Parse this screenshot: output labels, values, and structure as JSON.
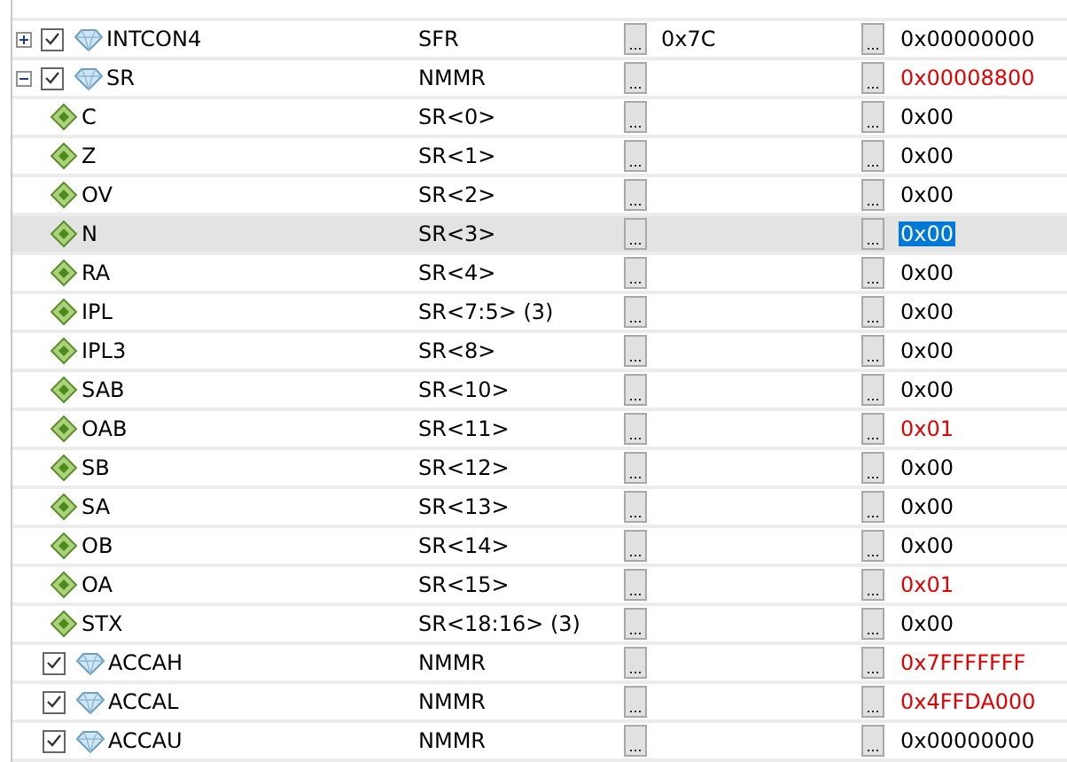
{
  "rows": [
    {
      "kind": "register",
      "name": "INTCON4",
      "type": "SFR",
      "buttons": [
        "...",
        "..."
      ],
      "address": "0x7C",
      "value": "0x00000000",
      "changed": false,
      "checked": true,
      "expanded": false,
      "selected": false
    },
    {
      "kind": "register",
      "name": "SR",
      "type": "NMMR",
      "buttons": [
        "...",
        "..."
      ],
      "value": "0x00008800",
      "changed": true,
      "checked": true,
      "expanded": true,
      "selected": false,
      "children": [
        {
          "kind": "bit",
          "name": "C",
          "type": "SR<0>",
          "buttons": [
            "...",
            "..."
          ],
          "value": "0x00",
          "changed": false,
          "selected": false
        },
        {
          "kind": "bit",
          "name": "Z",
          "type": "SR<1>",
          "buttons": [
            "...",
            "..."
          ],
          "value": "0x00",
          "changed": false,
          "selected": false
        },
        {
          "kind": "bit",
          "name": "OV",
          "type": "SR<2>",
          "buttons": [
            "...",
            "..."
          ],
          "value": "0x00",
          "changed": false,
          "selected": false
        },
        {
          "kind": "bit",
          "name": "N",
          "type": "SR<3>",
          "buttons": [
            "...",
            "..."
          ],
          "value": "0x00",
          "changed": false,
          "selected": true
        },
        {
          "kind": "bit",
          "name": "RA",
          "type": "SR<4>",
          "buttons": [
            "...",
            "..."
          ],
          "value": "0x00",
          "changed": false,
          "selected": false
        },
        {
          "kind": "bit",
          "name": "IPL",
          "type": "SR<7:5> (3)",
          "buttons": [
            "...",
            "..."
          ],
          "value": "0x00",
          "changed": false,
          "selected": false
        },
        {
          "kind": "bit",
          "name": "IPL3",
          "type": "SR<8>",
          "buttons": [
            "...",
            "..."
          ],
          "value": "0x00",
          "changed": false,
          "selected": false
        },
        {
          "kind": "bit",
          "name": "SAB",
          "type": "SR<10>",
          "buttons": [
            "...",
            "..."
          ],
          "value": "0x00",
          "changed": false,
          "selected": false
        },
        {
          "kind": "bit",
          "name": "OAB",
          "type": "SR<11>",
          "buttons": [
            "...",
            "..."
          ],
          "value": "0x01",
          "changed": true,
          "selected": false
        },
        {
          "kind": "bit",
          "name": "SB",
          "type": "SR<12>",
          "buttons": [
            "...",
            "..."
          ],
          "value": "0x00",
          "changed": false,
          "selected": false
        },
        {
          "kind": "bit",
          "name": "SA",
          "type": "SR<13>",
          "buttons": [
            "...",
            "..."
          ],
          "value": "0x00",
          "changed": false,
          "selected": false
        },
        {
          "kind": "bit",
          "name": "OB",
          "type": "SR<14>",
          "buttons": [
            "...",
            "..."
          ],
          "value": "0x00",
          "changed": false,
          "selected": false
        },
        {
          "kind": "bit",
          "name": "OA",
          "type": "SR<15>",
          "buttons": [
            "...",
            "..."
          ],
          "value": "0x01",
          "changed": true,
          "selected": false
        },
        {
          "kind": "bit",
          "name": "STX",
          "type": "SR<18:16> (3)",
          "buttons": [
            "...",
            "..."
          ],
          "value": "0x00",
          "changed": false,
          "selected": false
        }
      ]
    },
    {
      "kind": "register",
      "name": "ACCAH",
      "type": "NMMR",
      "buttons": [
        "...",
        "..."
      ],
      "value": "0x7FFFFFFF",
      "changed": true,
      "checked": true,
      "selected": false
    },
    {
      "kind": "register",
      "name": "ACCAL",
      "type": "NMMR",
      "buttons": [
        "...",
        "..."
      ],
      "value": "0x4FFDA000",
      "changed": true,
      "checked": true,
      "selected": false
    },
    {
      "kind": "register",
      "name": "ACCAU",
      "type": "NMMR",
      "buttons": [
        "...",
        "..."
      ],
      "value": "0x00000000",
      "changed": false,
      "checked": true,
      "selected": false
    }
  ]
}
